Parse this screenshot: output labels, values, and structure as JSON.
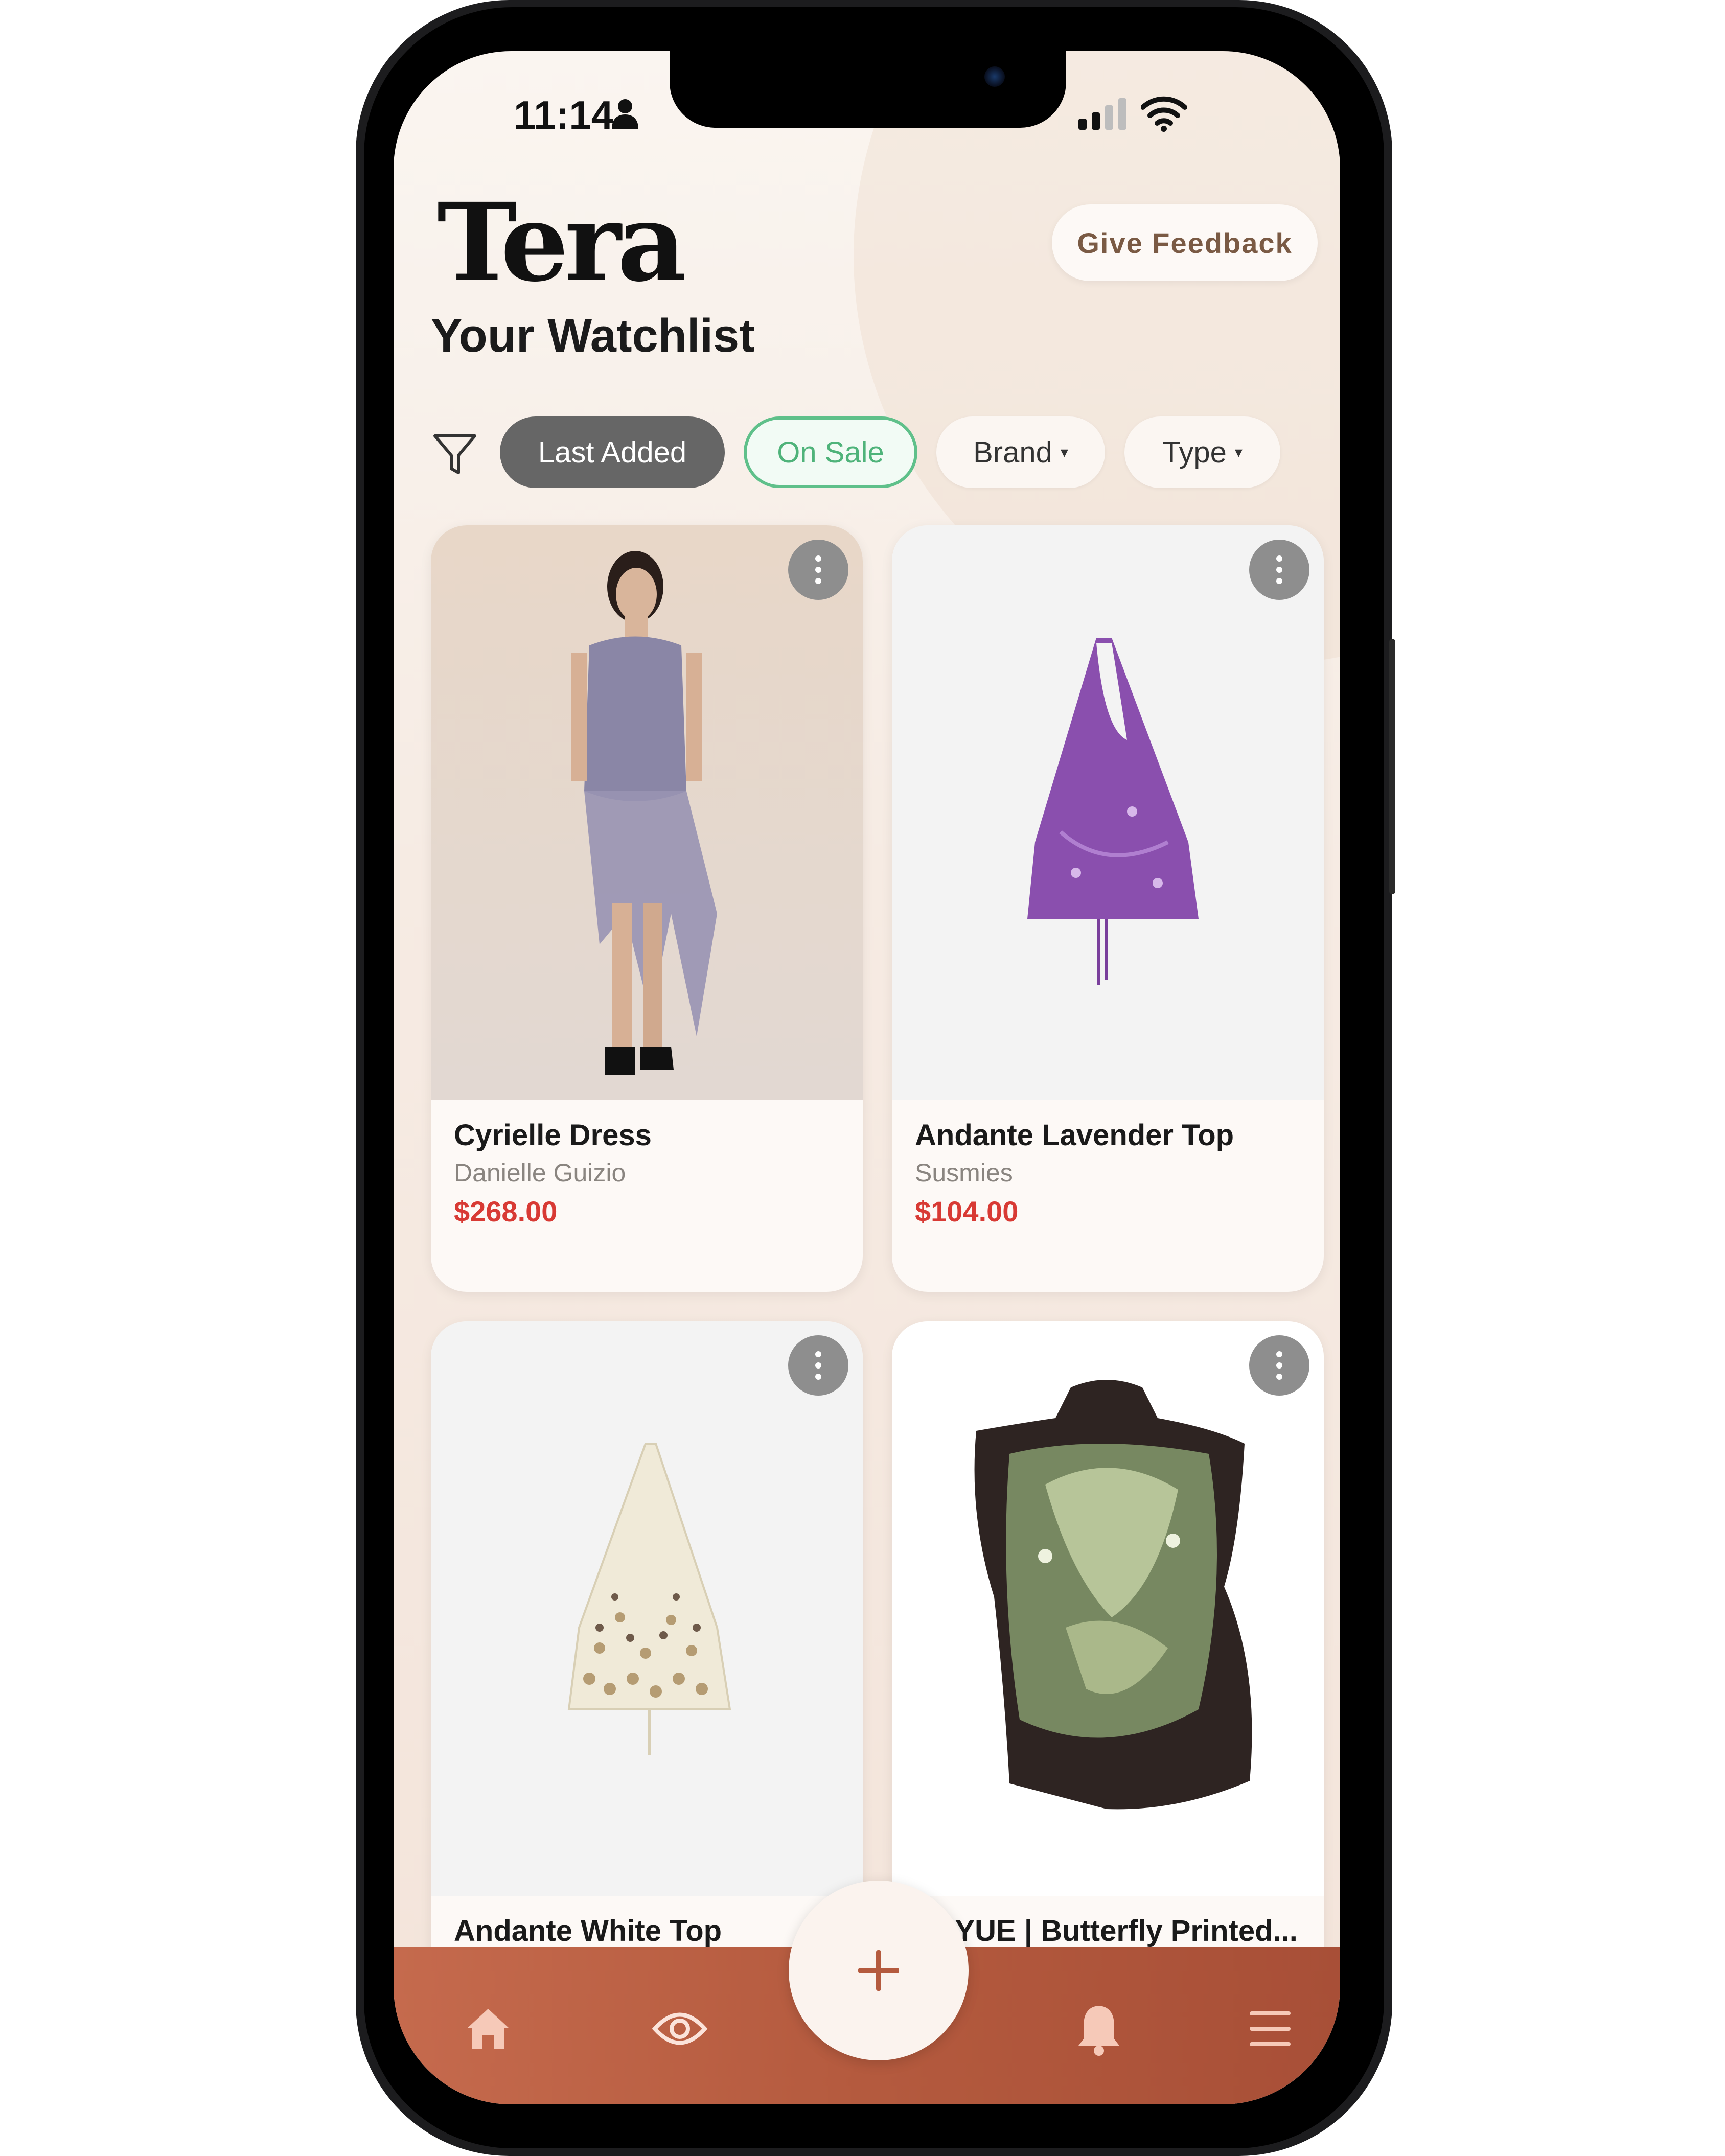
{
  "status_bar": {
    "time": "11:14"
  },
  "header": {
    "logo": "Tera",
    "title": "Your Watchlist",
    "feedback_label": "Give Feedback"
  },
  "filters": {
    "chips": [
      {
        "label": "Last Added",
        "state": "selected"
      },
      {
        "label": "On Sale",
        "state": "active"
      },
      {
        "label": "Brand",
        "has_dropdown": true
      },
      {
        "label": "Type",
        "has_dropdown": true
      }
    ],
    "dropdown_symbol": "▾"
  },
  "items": [
    {
      "title": "Cyrielle Dress",
      "brand": "Danielle Guizio",
      "price": "$268.00"
    },
    {
      "title": "Andante Lavender Top",
      "brand": "Susmies",
      "price": "$104.00"
    },
    {
      "title": "Andante White Top",
      "brand": "",
      "price": ""
    },
    {
      "title": "BAYUE | Butterfly Printed...",
      "brand": "",
      "price": ""
    }
  ],
  "tab_bar": {
    "tabs": [
      "home-icon",
      "eye-icon",
      "plus-icon",
      "bell-icon",
      "menu-icon"
    ]
  },
  "colors": {
    "accent": "#b45a3e",
    "price": "#d83a34",
    "sale_green": "#4fb37a",
    "chip_selected": "#666666"
  }
}
